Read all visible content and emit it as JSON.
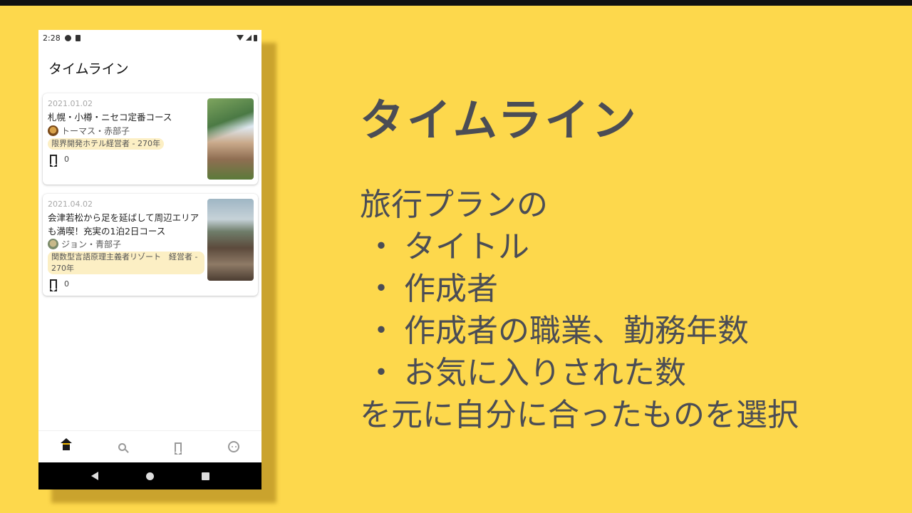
{
  "status_bar": {
    "time": "2:28"
  },
  "app": {
    "title": "タイムライン"
  },
  "timeline": [
    {
      "date": "2021.01.02",
      "title": "札幌・小樽・ニセコ定番コース",
      "author": "トーマス・赤部子",
      "job": "限界開発ホテル経営者 - 270年",
      "favorites": "0"
    },
    {
      "date": "2021.04.02",
      "title": "会津若松から足を延ばして周辺エリアも満喫！充実の1泊2日コース",
      "author": "ジョン・青部子",
      "job": "関数型言語原理主義者リゾート　経営者 - 270年",
      "favorites": "0"
    }
  ],
  "bottom_nav": [
    "home-icon",
    "search-icon",
    "bookmark-icon",
    "face-icon"
  ],
  "slide": {
    "title": "タイムライン",
    "intro": "旅行プランの",
    "bullets": [
      "タイトル",
      "作成者",
      "作成者の職業、勤務年数",
      "お気に入りされた数"
    ],
    "bullet_mark": "・",
    "outro": "を元に自分に合ったものを選択"
  },
  "colors": {
    "background": "#fdd84c",
    "text": "#4b4d55",
    "tag": "#fcefc4",
    "accent": "#f2b800"
  }
}
